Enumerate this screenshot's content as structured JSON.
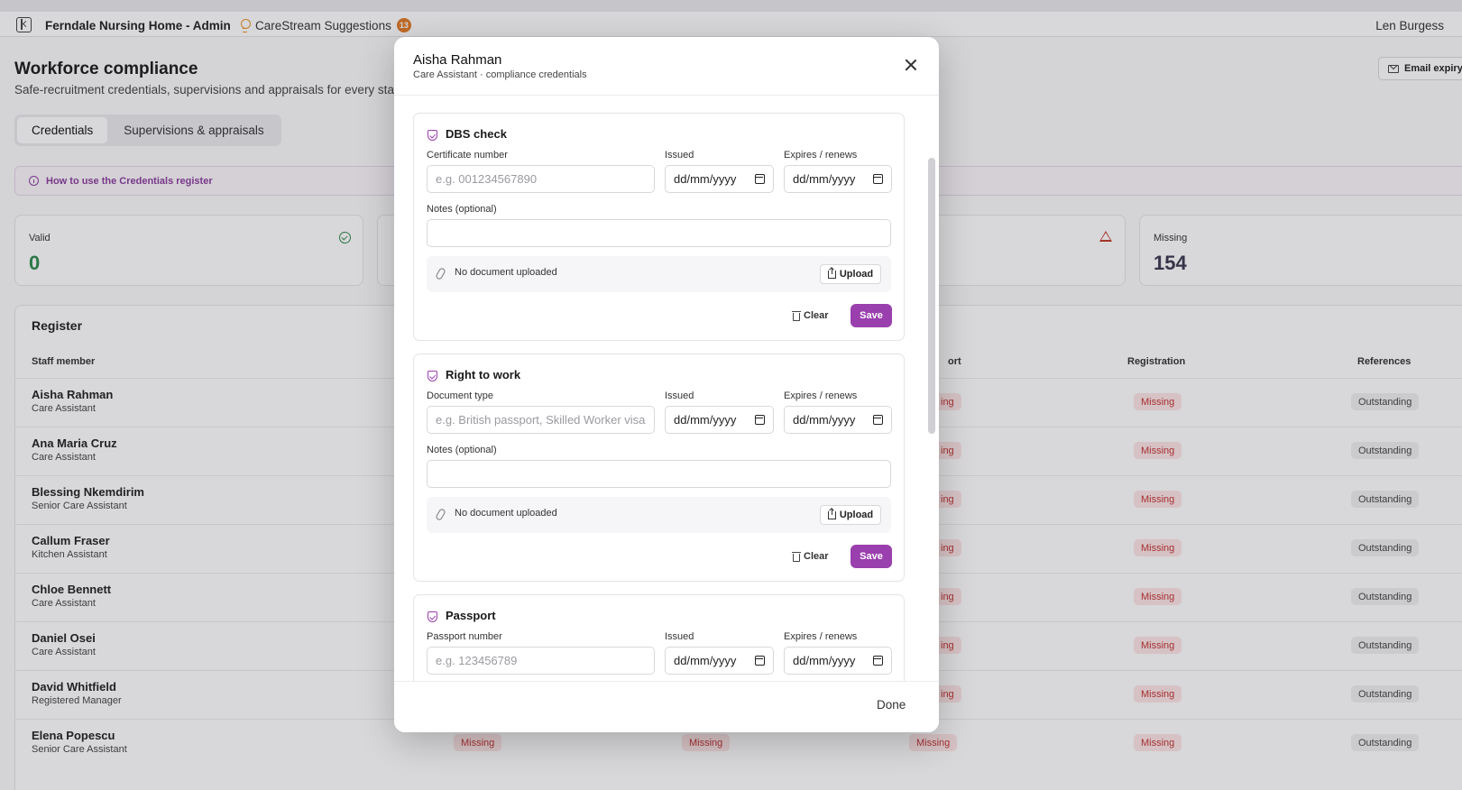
{
  "topbar": {
    "app_title": "Ferndale Nursing Home - Admin",
    "suggestions_label": "CareStream Suggestions",
    "suggestions_count": "13",
    "user_name": "Len Burgess"
  },
  "page": {
    "title": "Workforce compliance",
    "subtitle": "Safe-recruitment credentials, supervisions and appraisals for every sta",
    "email_button": "Email expiry",
    "tabs": [
      {
        "label": "Credentials",
        "active": true
      },
      {
        "label": "Supervisions & appraisals",
        "active": false
      }
    ],
    "howto_label": "How to use the Credentials register"
  },
  "stats": {
    "valid_label": "Valid",
    "valid_value": "0",
    "missing_label": "Missing",
    "missing_value": "154"
  },
  "register": {
    "title": "Register",
    "columns": {
      "staff": "Staff member",
      "passport_partial": "ort",
      "registration": "Registration",
      "references": "References"
    },
    "rows": [
      {
        "name": "Aisha Rahman",
        "role": "Care Assistant",
        "col3": "ing",
        "registration": "Missing",
        "references": "Outstanding"
      },
      {
        "name": "Ana Maria Cruz",
        "role": "Care Assistant",
        "col3": "ing",
        "registration": "Missing",
        "references": "Outstanding"
      },
      {
        "name": "Blessing Nkemdirim",
        "role": "Senior Care Assistant",
        "col3": "ing",
        "registration": "Missing",
        "references": "Outstanding"
      },
      {
        "name": "Callum Fraser",
        "role": "Kitchen Assistant",
        "col3": "ing",
        "registration": "Missing",
        "references": "Outstanding"
      },
      {
        "name": "Chloe Bennett",
        "role": "Care Assistant",
        "col3": "ing",
        "registration": "Missing",
        "references": "Outstanding"
      },
      {
        "name": "Daniel Osei",
        "role": "Care Assistant",
        "col3": "ing",
        "registration": "Missing",
        "references": "Outstanding"
      },
      {
        "name": "David Whitfield",
        "role": "Registered Manager",
        "col3": "ing",
        "registration": "Missing",
        "references": "Outstanding"
      },
      {
        "name": "Elena Popescu",
        "role": "Senior Care Assistant",
        "col1": "Missing",
        "col2": "Missing",
        "col3": "Missing",
        "registration": "Missing",
        "references": "Outstanding"
      }
    ]
  },
  "modal": {
    "title": "Aisha Rahman",
    "subtitle": "Care Assistant · compliance credentials",
    "done_label": "Done",
    "labels": {
      "issued": "Issued",
      "expires": "Expires / renews",
      "notes": "Notes (optional)",
      "no_document": "No document uploaded",
      "upload": "Upload",
      "clear": "Clear",
      "save": "Save",
      "date_placeholder": "dd/mm/yyyy"
    },
    "credentials": [
      {
        "title": "DBS check",
        "field_label": "Certificate number",
        "field_placeholder": "e.g. 001234567890"
      },
      {
        "title": "Right to work",
        "field_label": "Document type",
        "field_placeholder": "e.g. British passport, Skilled Worker visa"
      },
      {
        "title": "Passport",
        "field_label": "Passport number",
        "field_placeholder": "e.g. 123456789"
      }
    ]
  }
}
